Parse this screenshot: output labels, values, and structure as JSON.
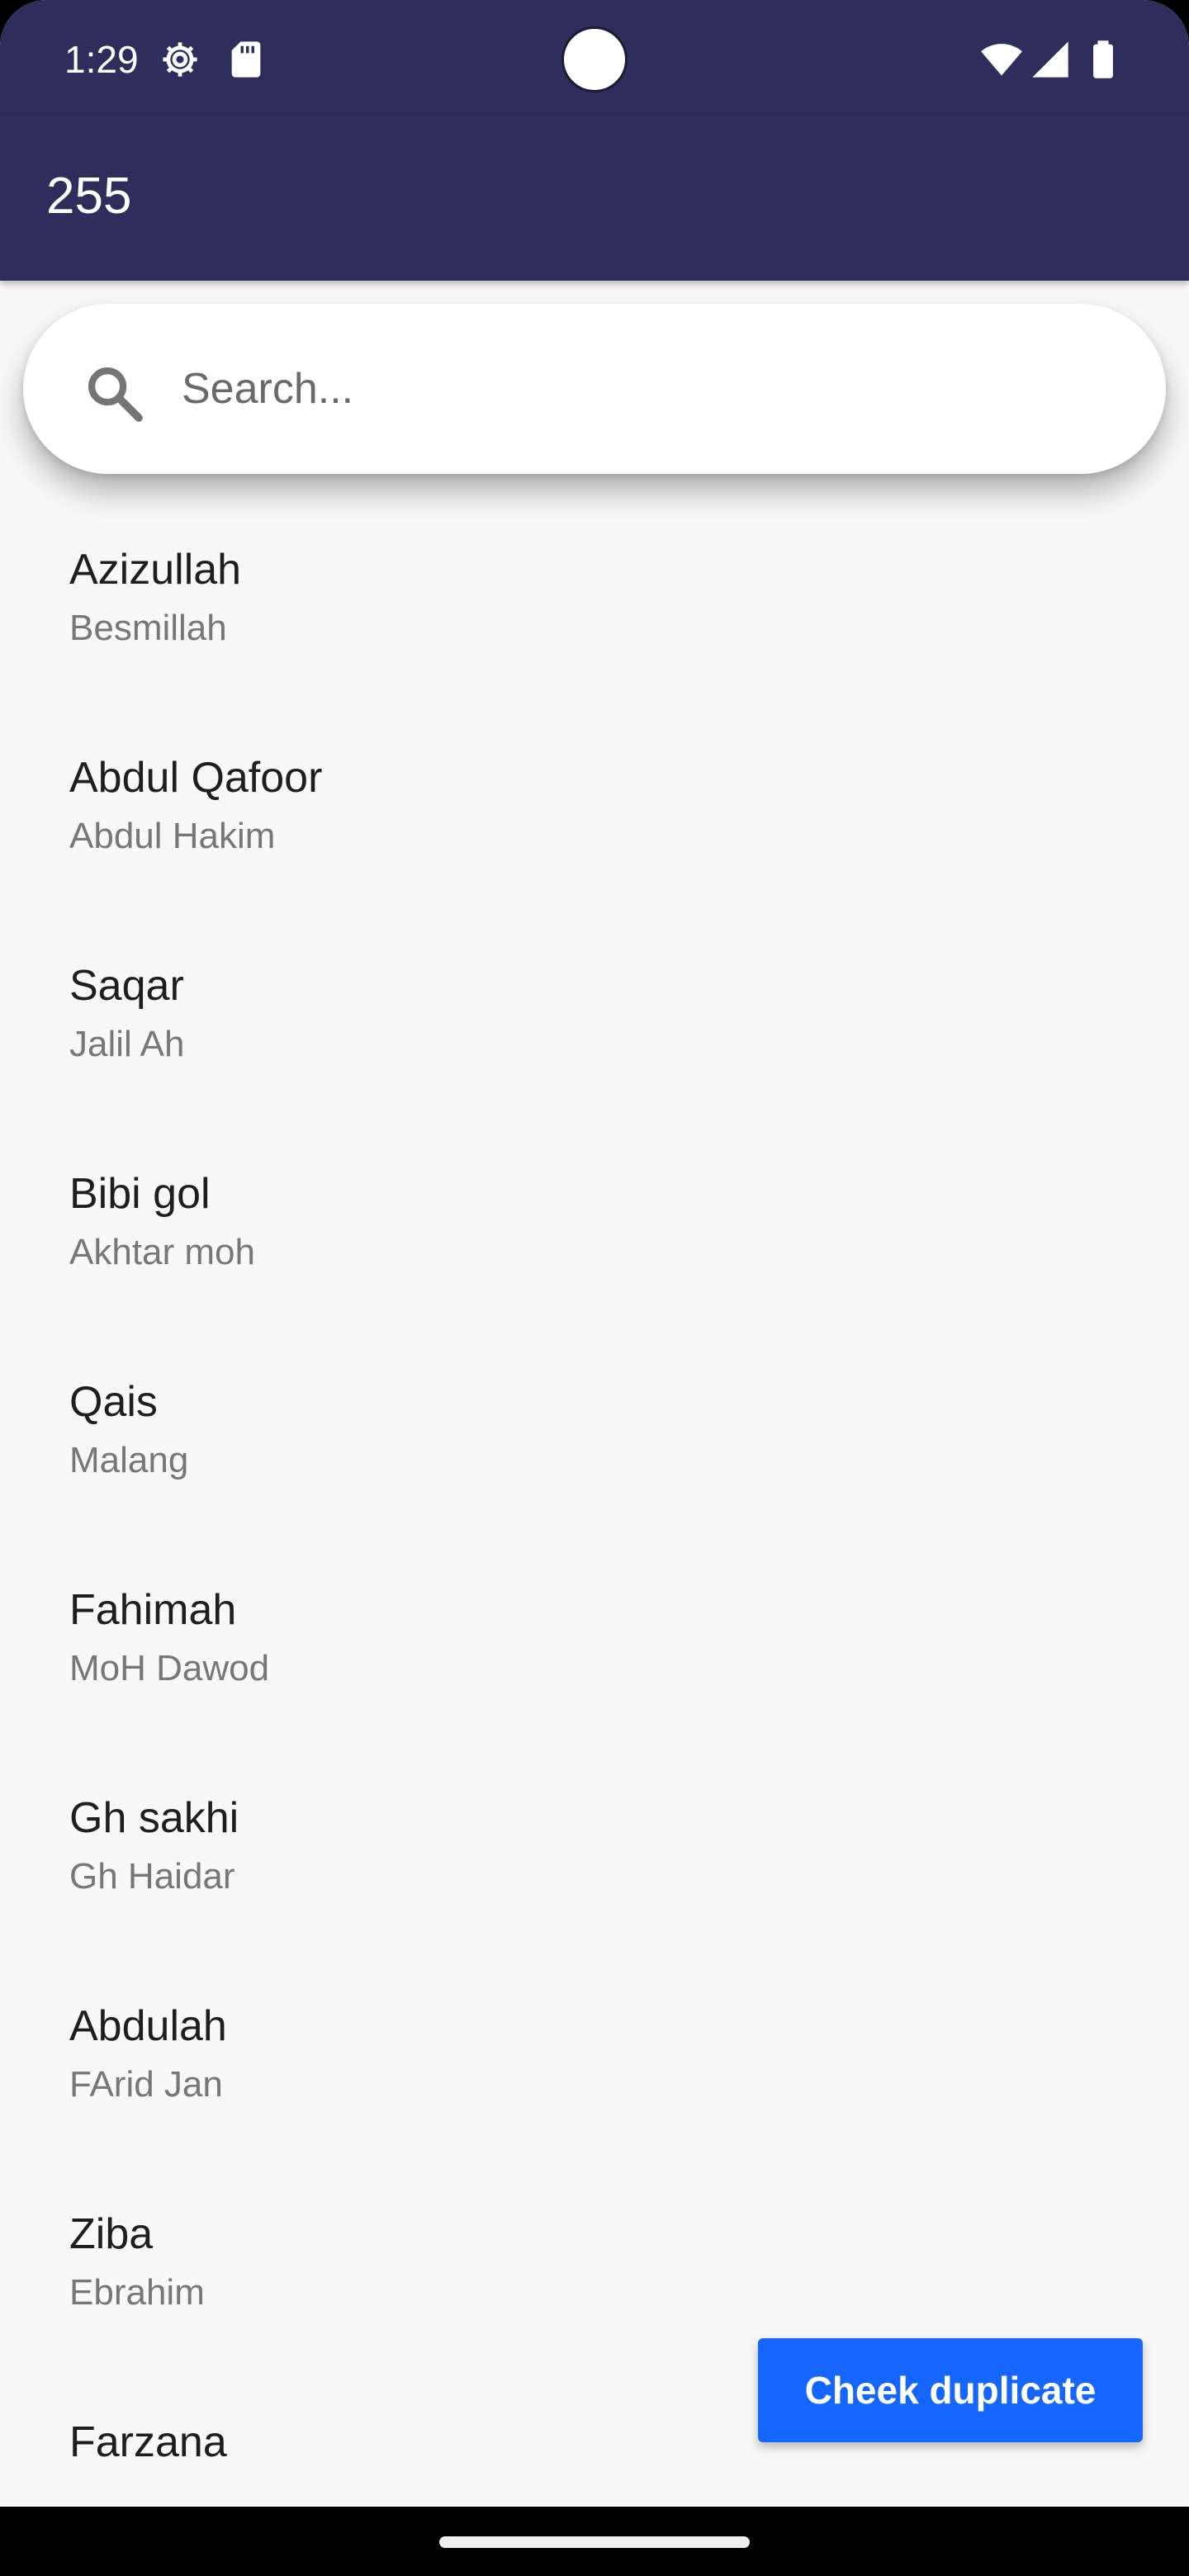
{
  "status_bar": {
    "time": "1:29",
    "icons": [
      "gear-icon",
      "sd-card-icon",
      "wifi-icon",
      "signal-icon",
      "battery-icon"
    ]
  },
  "app_bar": {
    "title": "255",
    "background_color": "#2e2d5b"
  },
  "search": {
    "placeholder": "Search...",
    "value": "",
    "icon": "search-icon"
  },
  "list": {
    "items": [
      {
        "title": "Azizullah",
        "subtitle": "Besmillah"
      },
      {
        "title": "Abdul Qafoor",
        "subtitle": "Abdul Hakim"
      },
      {
        "title": "Saqar",
        "subtitle": "Jalil Ah"
      },
      {
        "title": "Bibi gol",
        "subtitle": "Akhtar moh"
      },
      {
        "title": "Qais",
        "subtitle": "Malang"
      },
      {
        "title": "Fahimah",
        "subtitle": "MoH Dawod"
      },
      {
        "title": "Gh sakhi",
        "subtitle": "Gh Haidar"
      },
      {
        "title": "Abdulah",
        "subtitle": "FArid Jan"
      },
      {
        "title": "Ziba",
        "subtitle": "Ebrahim"
      },
      {
        "title": "Farzana",
        "subtitle": ""
      }
    ]
  },
  "action_button": {
    "label": "Cheek duplicate",
    "color": "#1466ff"
  }
}
